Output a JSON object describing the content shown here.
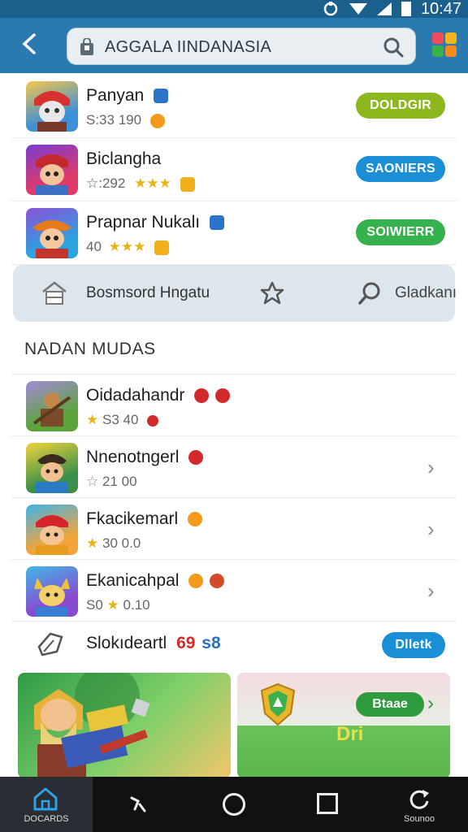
{
  "status_bar": {
    "time": "10:47"
  },
  "app_bar": {
    "search_text": "AGGALA IINDANASIA",
    "progress": 0.62
  },
  "top_list": [
    {
      "title": "Panyan",
      "rating": "S:33 190",
      "button": "DOLDGIR",
      "button_color": "#8cb81d"
    },
    {
      "title": "Biclangha",
      "rating": "☆:292",
      "button": "SAONIERS",
      "button_color": "#1a8fd6"
    },
    {
      "title": "Prapnar Nukalı",
      "rating": "40",
      "button": "SOIWIERR",
      "button_color": "#35b24d"
    }
  ],
  "toolbar": {
    "label": "Bosmsord Hngatu",
    "right_label": "Gladkanı"
  },
  "section_title": "NADAN  MUDAS",
  "list": [
    {
      "title": "Oidadahandr",
      "rating": "S3 40"
    },
    {
      "title": "Nnenotngerl",
      "rating": "21 00"
    },
    {
      "title": "Fkacikemarl",
      "rating": "30 0.0"
    },
    {
      "title": "Ekanicahpal",
      "rating": "S0",
      "rating2": "0.10"
    }
  ],
  "promo": {
    "title": "Slokıdeartl",
    "number": "69",
    "number2": "s8",
    "button": "Dlletk"
  },
  "banner_right": {
    "pill": "Btaae",
    "big_text": "Dri"
  },
  "nav": {
    "home_label": "DOCARDS",
    "right_label": "Sounoo"
  }
}
